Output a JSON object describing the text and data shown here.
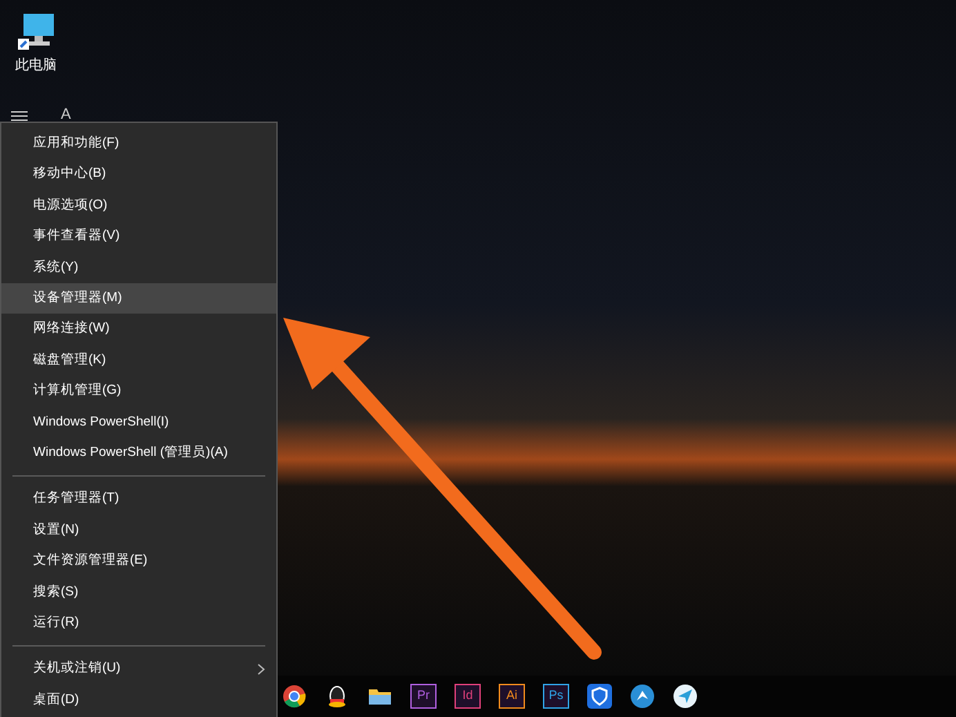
{
  "desktop_icons": [
    {
      "label": "此电脑"
    }
  ],
  "start_header": {
    "letter": "A"
  },
  "menu": {
    "groups": [
      [
        {
          "label": "应用和功能(F)",
          "selected": false,
          "submenu": false
        },
        {
          "label": "移动中心(B)",
          "selected": false,
          "submenu": false
        },
        {
          "label": "电源选项(O)",
          "selected": false,
          "submenu": false
        },
        {
          "label": "事件查看器(V)",
          "selected": false,
          "submenu": false
        },
        {
          "label": "系统(Y)",
          "selected": false,
          "submenu": false
        },
        {
          "label": "设备管理器(M)",
          "selected": true,
          "submenu": false
        },
        {
          "label": "网络连接(W)",
          "selected": false,
          "submenu": false
        },
        {
          "label": "磁盘管理(K)",
          "selected": false,
          "submenu": false
        },
        {
          "label": "计算机管理(G)",
          "selected": false,
          "submenu": false
        },
        {
          "label": "Windows PowerShell(I)",
          "selected": false,
          "submenu": false
        },
        {
          "label": "Windows PowerShell (管理员)(A)",
          "selected": false,
          "submenu": false
        }
      ],
      [
        {
          "label": "任务管理器(T)",
          "selected": false,
          "submenu": false
        },
        {
          "label": "设置(N)",
          "selected": false,
          "submenu": false
        },
        {
          "label": "文件资源管理器(E)",
          "selected": false,
          "submenu": false
        },
        {
          "label": "搜索(S)",
          "selected": false,
          "submenu": false
        },
        {
          "label": "运行(R)",
          "selected": false,
          "submenu": false
        }
      ],
      [
        {
          "label": "关机或注销(U)",
          "selected": false,
          "submenu": true
        },
        {
          "label": "桌面(D)",
          "selected": false,
          "submenu": false
        }
      ]
    ]
  },
  "taskbar": {
    "apps": [
      {
        "kind": "chrome"
      },
      {
        "kind": "penguin"
      },
      {
        "kind": "folder"
      },
      {
        "kind": "tile",
        "text": "Pr",
        "color": "#b05fe0"
      },
      {
        "kind": "tile",
        "text": "Id",
        "color": "#e0407a"
      },
      {
        "kind": "tile",
        "text": "Ai",
        "color": "#f08a1c"
      },
      {
        "kind": "tile",
        "text": "Ps",
        "color": "#2fa3e6"
      },
      {
        "kind": "shield"
      },
      {
        "kind": "bird"
      },
      {
        "kind": "plane"
      }
    ]
  }
}
